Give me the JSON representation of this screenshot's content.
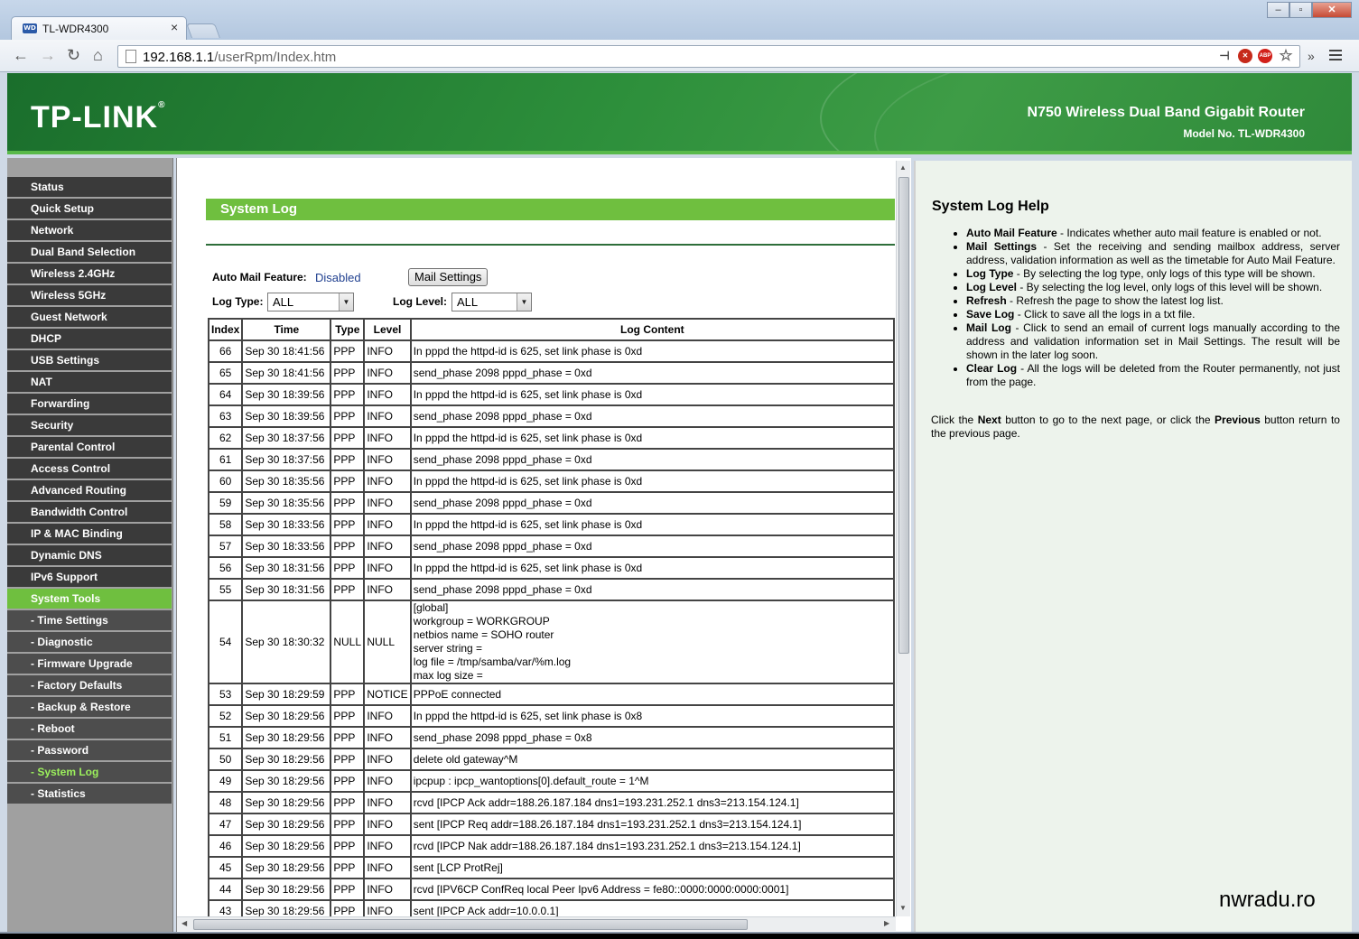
{
  "browser": {
    "tab_title": "TL-WDR4300",
    "tab_favicon": "WD",
    "url_host": "192.168.1.1",
    "url_path": "/userRpm/Index.htm",
    "icons": [
      "back-icon",
      "forward-icon",
      "reload-icon",
      "home-icon",
      "page-icon",
      "pin-icon",
      "block-icon",
      "adblock-icon",
      "star-icon",
      "menu-icon"
    ]
  },
  "banner": {
    "logo": "TP-LINK",
    "product": "N750 Wireless Dual Band Gigabit Router",
    "model": "Model No. TL-WDR4300"
  },
  "sidebar": {
    "items": [
      {
        "label": "Status",
        "state": "normal"
      },
      {
        "label": "Quick Setup",
        "state": "normal"
      },
      {
        "label": "Network",
        "state": "normal"
      },
      {
        "label": "Dual Band Selection",
        "state": "normal"
      },
      {
        "label": "Wireless 2.4GHz",
        "state": "normal"
      },
      {
        "label": "Wireless 5GHz",
        "state": "normal"
      },
      {
        "label": "Guest Network",
        "state": "normal"
      },
      {
        "label": "DHCP",
        "state": "normal"
      },
      {
        "label": "USB Settings",
        "state": "normal"
      },
      {
        "label": "NAT",
        "state": "normal"
      },
      {
        "label": "Forwarding",
        "state": "normal"
      },
      {
        "label": "Security",
        "state": "normal"
      },
      {
        "label": "Parental Control",
        "state": "normal"
      },
      {
        "label": "Access Control",
        "state": "normal"
      },
      {
        "label": "Advanced Routing",
        "state": "normal"
      },
      {
        "label": "Bandwidth Control",
        "state": "normal"
      },
      {
        "label": "IP & MAC Binding",
        "state": "normal"
      },
      {
        "label": "Dynamic DNS",
        "state": "normal"
      },
      {
        "label": "IPv6 Support",
        "state": "normal"
      },
      {
        "label": "System Tools",
        "state": "active"
      },
      {
        "label": "- Time Settings",
        "state": "sub"
      },
      {
        "label": "- Diagnostic",
        "state": "sub"
      },
      {
        "label": "- Firmware Upgrade",
        "state": "sub"
      },
      {
        "label": "- Factory Defaults",
        "state": "sub"
      },
      {
        "label": "- Backup & Restore",
        "state": "sub"
      },
      {
        "label": "- Reboot",
        "state": "sub"
      },
      {
        "label": "- Password",
        "state": "sub"
      },
      {
        "label": "- System Log",
        "state": "sub-active"
      },
      {
        "label": "- Statistics",
        "state": "sub"
      }
    ]
  },
  "main": {
    "title": "System Log",
    "auto_mail_label": "Auto Mail Feature:",
    "auto_mail_value": "Disabled",
    "mail_settings_button": "Mail Settings",
    "log_type_label": "Log Type:",
    "log_type_value": "ALL",
    "log_level_label": "Log Level:",
    "log_level_value": "ALL",
    "columns": [
      "Index",
      "Time",
      "Type",
      "Level",
      "Log Content"
    ],
    "rows": [
      [
        "66",
        "Sep 30 18:41:56",
        "PPP",
        "INFO",
        "In pppd the httpd-id is 625, set link phase is 0xd"
      ],
      [
        "65",
        "Sep 30 18:41:56",
        "PPP",
        "INFO",
        "send_phase 2098 pppd_phase = 0xd"
      ],
      [
        "64",
        "Sep 30 18:39:56",
        "PPP",
        "INFO",
        "In pppd the httpd-id is 625, set link phase is 0xd"
      ],
      [
        "63",
        "Sep 30 18:39:56",
        "PPP",
        "INFO",
        "send_phase 2098 pppd_phase = 0xd"
      ],
      [
        "62",
        "Sep 30 18:37:56",
        "PPP",
        "INFO",
        "In pppd the httpd-id is 625, set link phase is 0xd"
      ],
      [
        "61",
        "Sep 30 18:37:56",
        "PPP",
        "INFO",
        "send_phase 2098 pppd_phase = 0xd"
      ],
      [
        "60",
        "Sep 30 18:35:56",
        "PPP",
        "INFO",
        "In pppd the httpd-id is 625, set link phase is 0xd"
      ],
      [
        "59",
        "Sep 30 18:35:56",
        "PPP",
        "INFO",
        "send_phase 2098 pppd_phase = 0xd"
      ],
      [
        "58",
        "Sep 30 18:33:56",
        "PPP",
        "INFO",
        "In pppd the httpd-id is 625, set link phase is 0xd"
      ],
      [
        "57",
        "Sep 30 18:33:56",
        "PPP",
        "INFO",
        "send_phase 2098 pppd_phase = 0xd"
      ],
      [
        "56",
        "Sep 30 18:31:56",
        "PPP",
        "INFO",
        "In pppd the httpd-id is 625, set link phase is 0xd"
      ],
      [
        "55",
        "Sep 30 18:31:56",
        "PPP",
        "INFO",
        "send_phase 2098 pppd_phase = 0xd"
      ],
      [
        "54",
        "Sep 30 18:30:32",
        "NULL",
        "NULL",
        "[global]\nworkgroup = WORKGROUP\nnetbios name = SOHO router\nserver string =\nlog file = /tmp/samba/var/%m.log\nmax log size ="
      ],
      [
        "53",
        "Sep 30 18:29:59",
        "PPP",
        "NOTICE",
        "PPPoE connected"
      ],
      [
        "52",
        "Sep 30 18:29:56",
        "PPP",
        "INFO",
        "In pppd the httpd-id is 625, set link phase is 0x8"
      ],
      [
        "51",
        "Sep 30 18:29:56",
        "PPP",
        "INFO",
        "send_phase 2098 pppd_phase = 0x8"
      ],
      [
        "50",
        "Sep 30 18:29:56",
        "PPP",
        "INFO",
        "delete old gateway^M"
      ],
      [
        "49",
        "Sep 30 18:29:56",
        "PPP",
        "INFO",
        "ipcpup : ipcp_wantoptions[0].default_route = 1^M"
      ],
      [
        "48",
        "Sep 30 18:29:56",
        "PPP",
        "INFO",
        "rcvd [IPCP Ack addr=188.26.187.184 dns1=193.231.252.1 dns3=213.154.124.1]"
      ],
      [
        "47",
        "Sep 30 18:29:56",
        "PPP",
        "INFO",
        "sent [IPCP Req addr=188.26.187.184 dns1=193.231.252.1 dns3=213.154.124.1]"
      ],
      [
        "46",
        "Sep 30 18:29:56",
        "PPP",
        "INFO",
        "rcvd [IPCP Nak addr=188.26.187.184 dns1=193.231.252.1 dns3=213.154.124.1]"
      ],
      [
        "45",
        "Sep 30 18:29:56",
        "PPP",
        "INFO",
        "sent [LCP ProtRej]"
      ],
      [
        "44",
        "Sep 30 18:29:56",
        "PPP",
        "INFO",
        "rcvd [IPV6CP ConfReq local Peer Ipv6 Address = fe80::0000:0000:0000:0001]"
      ],
      [
        "43",
        "Sep 30 18:29:56",
        "PPP",
        "INFO",
        "sent [IPCP Ack addr=10.0.0.1]"
      ]
    ]
  },
  "help": {
    "title": "System Log Help",
    "items": [
      {
        "term": "Auto Mail Feature",
        "text": " - Indicates whether auto mail feature is enabled or not."
      },
      {
        "term": "Mail Settings",
        "text": " - Set the receiving and sending mailbox address, server address, validation information as well as the timetable for Auto Mail Feature."
      },
      {
        "term": "Log Type",
        "text": " - By selecting the log type, only logs of this type will be shown."
      },
      {
        "term": "Log Level",
        "text": " - By selecting the log level, only logs of this level will be shown."
      },
      {
        "term": "Refresh",
        "text": " - Refresh the page to show the latest log list."
      },
      {
        "term": "Save Log",
        "text": " - Click to save all the logs in a txt file."
      },
      {
        "term": "Mail Log",
        "text": " - Click to send an email of current logs manually according to the address and validation information set in Mail Settings. The result will be shown in the later log soon."
      },
      {
        "term": "Clear Log",
        "text": " - All the logs will be deleted from the Router permanently, not just from the page."
      }
    ],
    "footer_parts": [
      "Click the ",
      "Next",
      " button to go to the next page, or click the ",
      "Previous",
      " button return to the previous page."
    ]
  },
  "watermark": "nwradu.ro",
  "colors": {
    "accent_green": "#6fbf3f",
    "banner_green": "#2d8f3b",
    "menu_dark": "#3a3a3a",
    "link_blue": "#1f3f8f"
  }
}
